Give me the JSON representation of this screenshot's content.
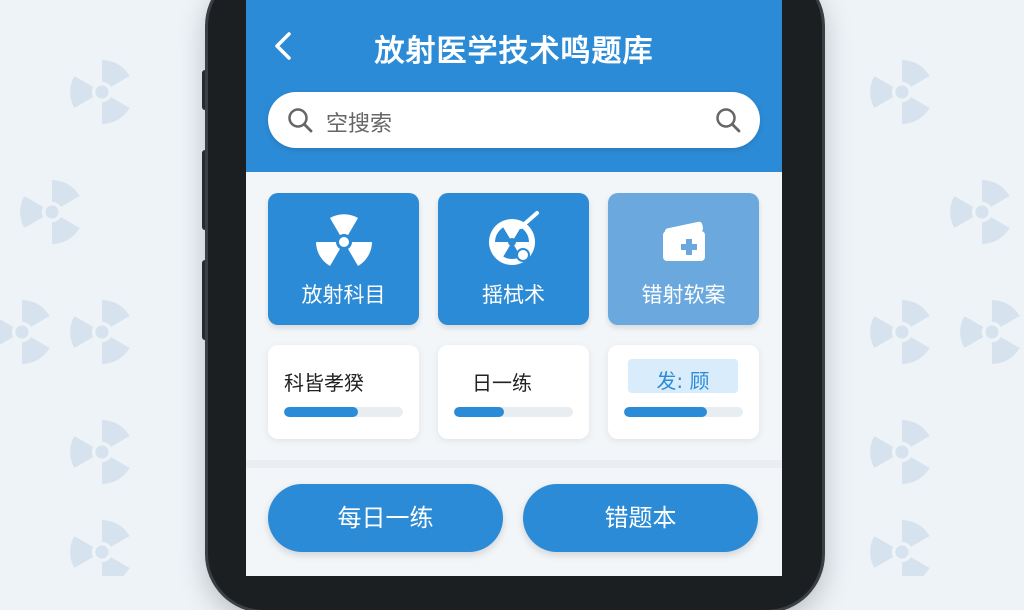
{
  "header": {
    "back_label": "‹",
    "title": "放射医学技术鸣题库"
  },
  "search": {
    "placeholder": "空搜索"
  },
  "tiles": [
    {
      "label": "放射科目",
      "icon": "radiation-icon"
    },
    {
      "label": "揺栻术",
      "icon": "scan-icon"
    },
    {
      "label": "错射软案",
      "icon": "medical-card-icon"
    }
  ],
  "progress": [
    {
      "label": "科皆孝猤",
      "progress": 0.62
    },
    {
      "label": "日一练",
      "progress": 0.42
    },
    {
      "label": "发: 顾",
      "progress": 0.7
    }
  ],
  "actions": {
    "daily": "每日一练",
    "wrong": "错题本"
  },
  "colors": {
    "primary": "#2c8bd6",
    "soft": "#6aa8dd",
    "badge": "#d8ecfb"
  }
}
